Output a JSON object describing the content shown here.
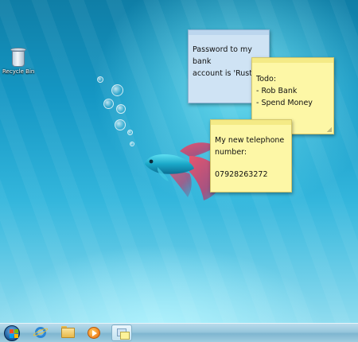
{
  "desktop": {
    "icons": [
      {
        "label": "Recycle Bin",
        "icon": "recycle-bin-icon"
      }
    ]
  },
  "sticky_notes": [
    {
      "color": "#cfe3f4",
      "text": "Password to my bank\naccount is 'Rusty'"
    },
    {
      "color": "#fdf7a6",
      "text": "Todo:\n   - Rob Bank\n   - Spend Money"
    },
    {
      "color": "#fdf7a6",
      "text": "My new telephone\nnumber:",
      "number": "07928263272"
    }
  ],
  "taskbar": {
    "start_icon": "windows-start-orb",
    "pinned": [
      {
        "name": "internet-explorer-icon"
      },
      {
        "name": "windows-explorer-icon"
      },
      {
        "name": "windows-media-player-icon"
      },
      {
        "name": "sticky-notes-icon",
        "active": true
      }
    ]
  }
}
